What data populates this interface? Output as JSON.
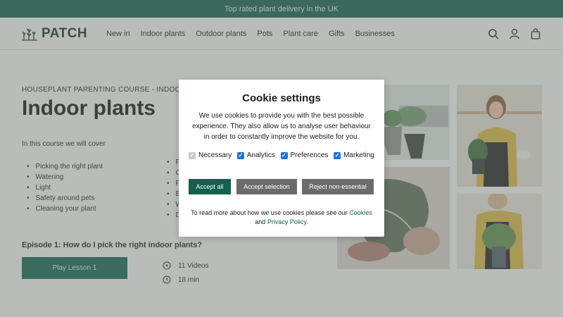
{
  "promo": {
    "text": "Top rated plant delivery in the UK"
  },
  "header": {
    "logo": "PATCH",
    "nav": [
      "New in",
      "Indoor plants",
      "Outdoor plants",
      "Pots",
      "Plant care",
      "Gifts",
      "Businesses"
    ]
  },
  "course": {
    "kicker": "HOUSEPLANT PARENTING COURSE - INDOOR PLANTS",
    "title": "Indoor plants",
    "intro": "In this course we will cover",
    "topics_left": [
      "Picking the right plant",
      "Watering",
      "Light",
      "Safety around pets",
      "Cleaning your plant"
    ],
    "topics_right": [
      "Pl",
      "Ch",
      "Pr",
      "Bu",
      "W",
      "Do"
    ],
    "episode": "Episode 1: How do I pick the right indoor plants?",
    "play_label": "Play Lesson 1",
    "videos": "11 Videos",
    "duration": "18 min"
  },
  "cookie": {
    "title": "Cookie settings",
    "body": "We use cookies to provide you with the best possible experience. They also allow us to analyse user behaviour in order to constantly improve the website for you.",
    "options": [
      {
        "label": "Necessary",
        "checked": true,
        "disabled": true
      },
      {
        "label": "Analytics",
        "checked": true,
        "disabled": false
      },
      {
        "label": "Preferences",
        "checked": true,
        "disabled": false
      },
      {
        "label": "Marketing",
        "checked": true,
        "disabled": false
      }
    ],
    "accept_all": "Accept all",
    "accept_selection": "Accept selection",
    "reject": "Reject non-essential",
    "footer_prefix": "To read more about how we use cookies please see our",
    "cookies_link": "Cookies",
    "footer_and": "and",
    "privacy_link": "Privacy Policy."
  },
  "colors": {
    "brand": "#12604e",
    "promo_bg": "#0f5b4a",
    "button_grey": "#6b6b6b",
    "checkbox": "#1a73e8"
  },
  "icons": [
    "search-icon",
    "account-icon",
    "bag-icon",
    "play-circle-icon",
    "clock-icon"
  ]
}
